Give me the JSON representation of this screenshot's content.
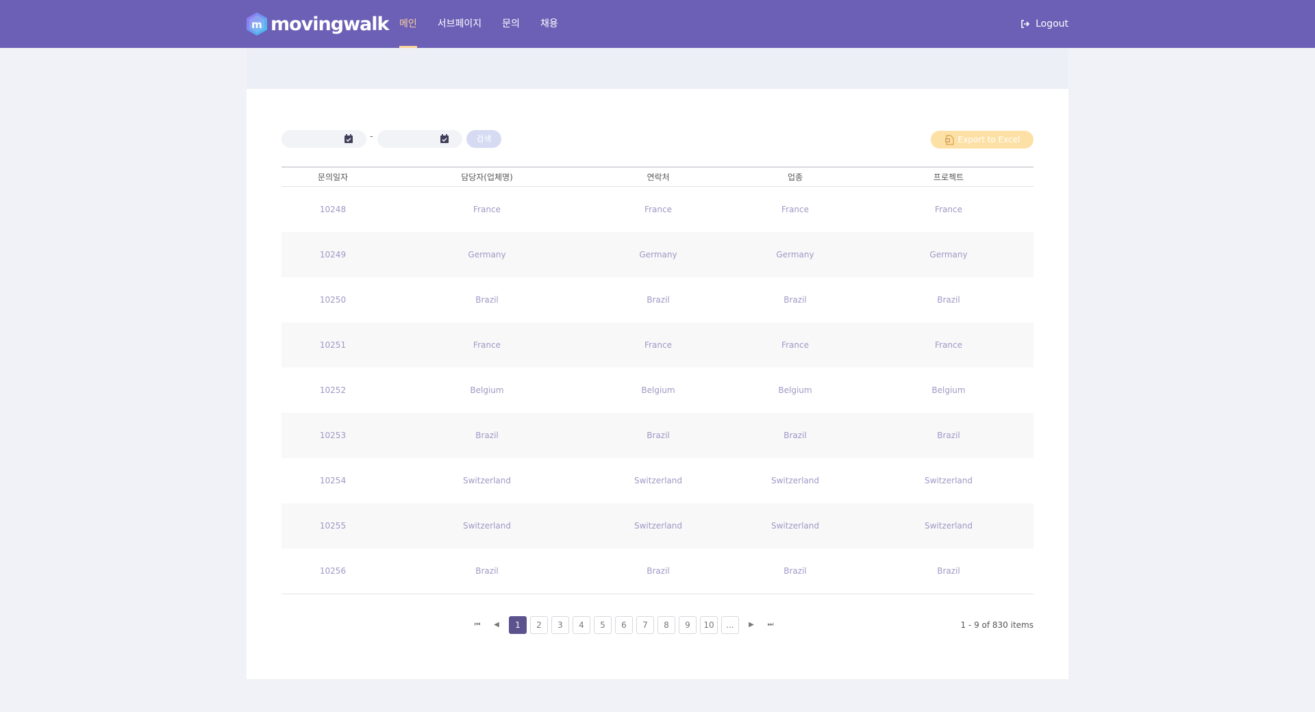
{
  "header": {
    "logo_text": "movingwalk",
    "nav": [
      {
        "label": "메인",
        "active": true
      },
      {
        "label": "서브페이지",
        "active": false
      },
      {
        "label": "문의",
        "active": false
      },
      {
        "label": "채용",
        "active": false
      }
    ],
    "logout_label": "Logout"
  },
  "filters": {
    "start_date": {
      "value": "",
      "placeholder": ""
    },
    "end_date": {
      "value": "",
      "placeholder": ""
    },
    "separator": "-",
    "search_label": "검색",
    "export_label": "Export to Excel"
  },
  "table": {
    "columns": [
      "문의일자",
      "담당자(업체명)",
      "연락처",
      "업종",
      "프로젝트"
    ],
    "rows": [
      [
        "10248",
        "France",
        "France",
        "France",
        "France"
      ],
      [
        "10249",
        "Germany",
        "Germany",
        "Germany",
        "Germany"
      ],
      [
        "10250",
        "Brazil",
        "Brazil",
        "Brazil",
        "Brazil"
      ],
      [
        "10251",
        "France",
        "France",
        "France",
        "France"
      ],
      [
        "10252",
        "Belgium",
        "Belgium",
        "Belgium",
        "Belgium"
      ],
      [
        "10253",
        "Brazil",
        "Brazil",
        "Brazil",
        "Brazil"
      ],
      [
        "10254",
        "Switzerland",
        "Switzerland",
        "Switzerland",
        "Switzerland"
      ],
      [
        "10255",
        "Switzerland",
        "Switzerland",
        "Switzerland",
        "Switzerland"
      ],
      [
        "10256",
        "Brazil",
        "Brazil",
        "Brazil",
        "Brazil"
      ]
    ]
  },
  "pagination": {
    "pages": [
      "1",
      "2",
      "3",
      "4",
      "5",
      "6",
      "7",
      "8",
      "9",
      "10",
      "..."
    ],
    "current": "1",
    "info": "1 - 9 of 830 items"
  },
  "colors": {
    "header_bg": "#6c5fb6",
    "nav_active": "#fbd29a",
    "cell_text": "#9f97c4",
    "page_active": "#5c538e",
    "export_btn": "#fde0a5",
    "search_btn": "#d6dbf3"
  },
  "icons": {
    "logout": "sign-out-icon",
    "calendar": "calendar-check-icon",
    "export": "excel-file-icon",
    "first": "first-page-icon",
    "prev": "prev-page-icon",
    "next": "next-page-icon",
    "last": "last-page-icon"
  }
}
